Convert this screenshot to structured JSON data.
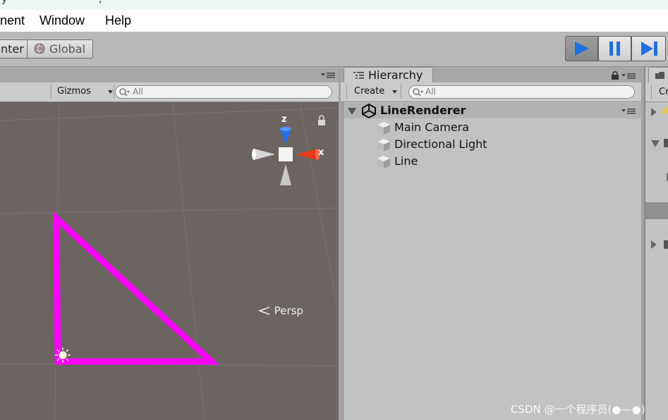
{
  "window": {
    "title_fragment": "y",
    "title_suffix": ","
  },
  "menu": {
    "items": [
      "nent",
      "Window",
      "Help"
    ]
  },
  "toolbar": {
    "pivot_label": "nter",
    "global_label": "Global",
    "play_controls": [
      "play-icon",
      "pause-icon",
      "step-icon"
    ],
    "play_accent": "#1f6fe0"
  },
  "scene": {
    "gizmos_label": "Gizmos",
    "search_placeholder": "All",
    "persp_label": "Persp",
    "axis_labels": {
      "z": "z",
      "x": "x"
    },
    "line_color": "#ff00ff",
    "background": "#6b6460"
  },
  "hierarchy": {
    "tab_label": "Hierarchy",
    "create_label": "Create",
    "search_placeholder": "All",
    "scene_name": "LineRenderer",
    "items": [
      {
        "label": "Main Camera"
      },
      {
        "label": "Directional Light"
      },
      {
        "label": "Line"
      }
    ]
  },
  "right_panel": {
    "toolbar_label": "Cr"
  },
  "watermark": "CSDN @一个程序员(●—●)"
}
